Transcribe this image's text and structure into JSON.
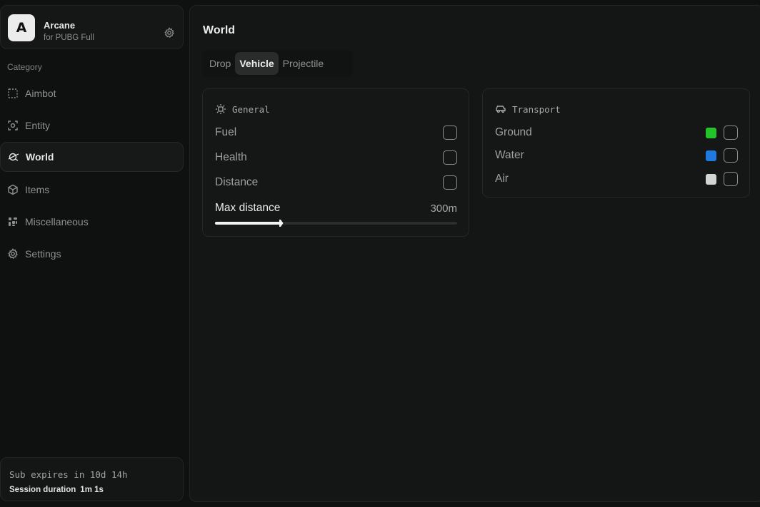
{
  "app": {
    "logo_letter": "A",
    "name": "Arcane",
    "subtitle": "for PUBG Full"
  },
  "sidebar": {
    "category_label": "Category",
    "items": [
      {
        "label": "Aimbot",
        "icon": "crosshair-dotted-square-icon",
        "active": false
      },
      {
        "label": "Entity",
        "icon": "entity-target-icon",
        "active": false
      },
      {
        "label": "World",
        "icon": "world-icon",
        "active": true
      },
      {
        "label": "Items",
        "icon": "box-icon",
        "active": false
      },
      {
        "label": "Miscellaneous",
        "icon": "misc-icon",
        "active": false
      },
      {
        "label": "Settings",
        "icon": "gear-icon",
        "active": false
      }
    ]
  },
  "subscription": {
    "expires_text": "Sub expires in 10d 14h",
    "session_label": "Session duration",
    "session_value": "1m 1s"
  },
  "main": {
    "title": "World",
    "tabs": [
      {
        "label": "Drop",
        "active": false
      },
      {
        "label": "Vehicle",
        "active": true
      },
      {
        "label": "Projectile",
        "active": false
      }
    ],
    "general": {
      "title": "General",
      "icon": "sun-icon",
      "options": [
        {
          "label": "Fuel",
          "checked": false
        },
        {
          "label": "Health",
          "checked": false
        },
        {
          "label": "Distance",
          "checked": false
        }
      ],
      "max_distance": {
        "label": "Max distance",
        "value": "300m",
        "fraction": 0.27
      }
    },
    "transport": {
      "title": "Transport",
      "icon": "car-icon",
      "options": [
        {
          "label": "Ground",
          "color": "#22c42a",
          "checked": false
        },
        {
          "label": "Water",
          "color": "#1f7ae0",
          "checked": false
        },
        {
          "label": "Air",
          "color": "#d4d4d4",
          "checked": false
        }
      ]
    }
  }
}
